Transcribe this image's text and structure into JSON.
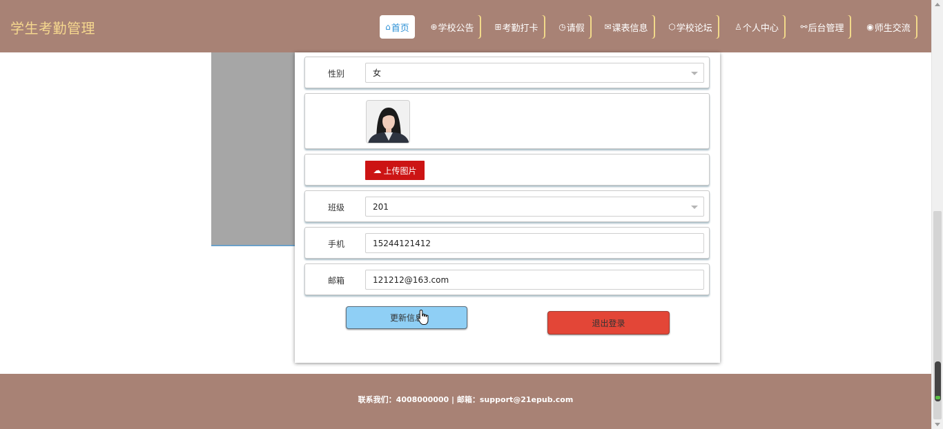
{
  "app": {
    "title": "学生考勤管理"
  },
  "nav": [
    {
      "icon": "⌂",
      "label": "首页"
    },
    {
      "icon": "⊕",
      "label": "学校公告"
    },
    {
      "icon": "⊞",
      "label": "考勤打卡"
    },
    {
      "icon": "◷",
      "label": "请假"
    },
    {
      "icon": "✉",
      "label": "课表信息"
    },
    {
      "icon": "⬡",
      "label": "学校论坛"
    },
    {
      "icon": "♙",
      "label": "个人中心"
    },
    {
      "icon": "⚯",
      "label": "后台管理"
    },
    {
      "icon": "◉",
      "label": "师生交流"
    }
  ],
  "form": {
    "gender": {
      "label": "性别",
      "value": "女"
    },
    "photo": {
      "icon": "avatar-photo"
    },
    "upload": {
      "icon": "☁",
      "label": "上传图片"
    },
    "class": {
      "label": "班级",
      "value": "201"
    },
    "phone": {
      "label": "手机",
      "value": "15244121412"
    },
    "email": {
      "label": "邮箱",
      "value": "121212@163.com"
    }
  },
  "actions": {
    "update_label": "更新信息",
    "logout_label": "退出登录"
  },
  "footer": {
    "text": "联系我们：4008000000 | 邮箱：support@21epub.com"
  },
  "colors": {
    "header_bg": "#a88275",
    "brand_text": "#f5d78e",
    "nav_active_text": "#2a8fd6",
    "upload_btn": "#cc1414",
    "update_btn": "#8fcff5",
    "logout_btn": "#e34637"
  }
}
